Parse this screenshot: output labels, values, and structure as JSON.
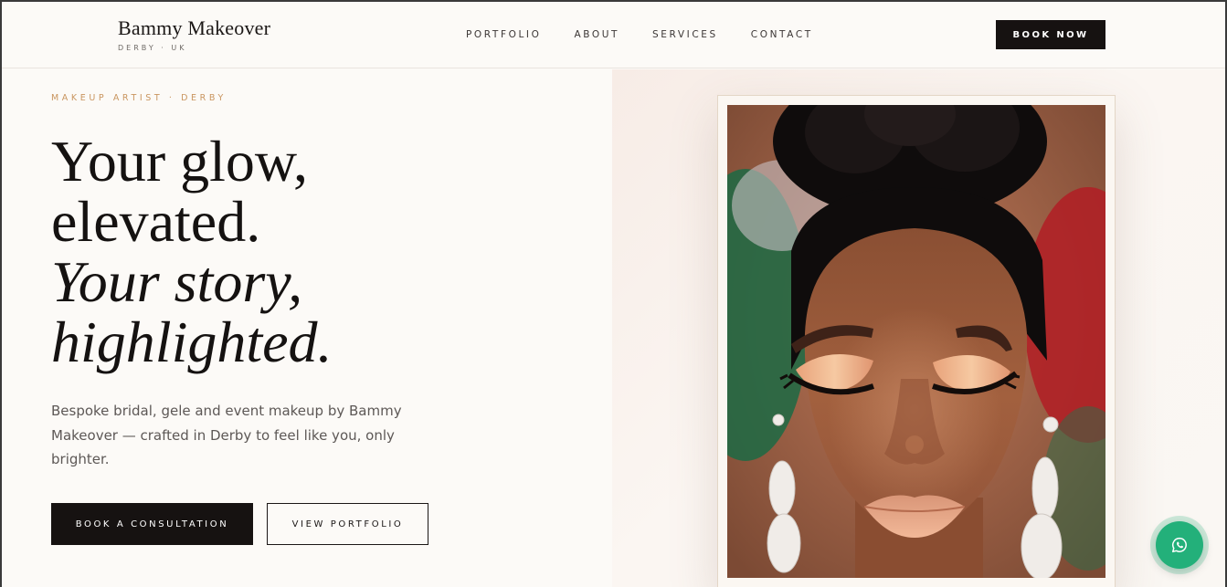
{
  "brand": {
    "name": "Bammy Makeover",
    "location": "DERBY · UK"
  },
  "nav": {
    "items": [
      {
        "label": "PORTFOLIO"
      },
      {
        "label": "ABOUT"
      },
      {
        "label": "SERVICES"
      },
      {
        "label": "CONTACT"
      }
    ],
    "cta_label": "BOOK NOW"
  },
  "hero": {
    "eyebrow": "MAKEUP ARTIST · DERBY",
    "headline_lines": [
      "Your glow,",
      "elevated.",
      "Your story,",
      "highlighted."
    ],
    "lede": "Bespoke bridal, gele and event makeup by Bammy Makeover — crafted in Derby to feel like you, only brighter.",
    "primary_cta": "BOOK A CONSULTATION",
    "secondary_cta": "VIEW PORTFOLIO"
  },
  "colors": {
    "accent": "#c9955f",
    "ink": "#161211",
    "background": "#fcfaf7",
    "whatsapp": "#23b07a"
  },
  "icons": {
    "chat": "whatsapp-icon"
  }
}
